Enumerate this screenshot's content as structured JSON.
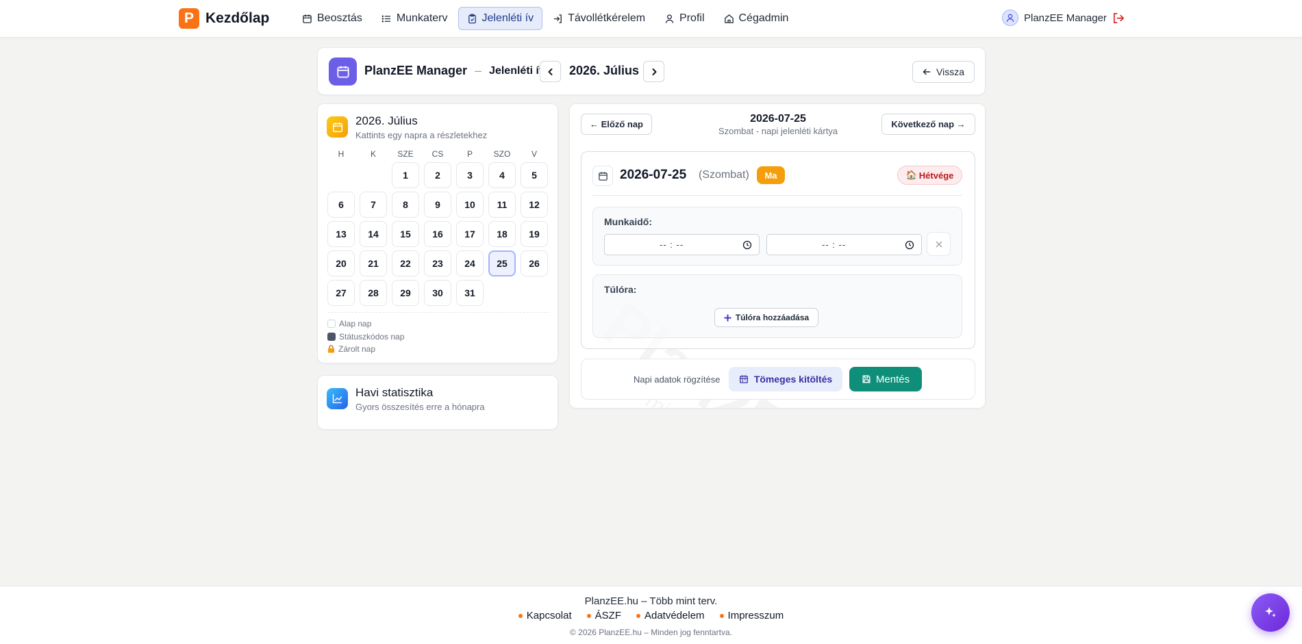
{
  "brand": {
    "logo_letter": "P",
    "name": "Kezdőlap",
    "accent": "#f97316"
  },
  "nav": [
    {
      "label": "Beosztás",
      "icon": "calendar-icon",
      "active": false
    },
    {
      "label": "Munkaterv",
      "icon": "list-icon",
      "active": false
    },
    {
      "label": "Jelenléti ív",
      "icon": "clipboard-icon",
      "active": true
    },
    {
      "label": "Távollétkérelem",
      "icon": "login-icon",
      "active": false
    },
    {
      "label": "Profil",
      "icon": "user-icon",
      "active": false
    },
    {
      "label": "Cégadmin",
      "icon": "home-icon",
      "active": false
    }
  ],
  "user": {
    "name": "PlanzEE Manager"
  },
  "header": {
    "company": "PlanzEE Manager",
    "separator": "–",
    "page": "Jelenléti ív",
    "month": "2026. Július",
    "back_label": "Vissza"
  },
  "calendar": {
    "title": "2026. Július",
    "subtitle": "Kattints egy napra a részletekhez",
    "weekdays": [
      "H",
      "K",
      "SZE",
      "CS",
      "P",
      "SZO",
      "V"
    ],
    "days": [
      "1",
      "2",
      "3",
      "4",
      "5",
      "6",
      "7",
      "8",
      "9",
      "10",
      "11",
      "12",
      "13",
      "14",
      "15",
      "16",
      "17",
      "18",
      "19",
      "20",
      "21",
      "22",
      "23",
      "24",
      "25",
      "26",
      "27",
      "28",
      "29",
      "30",
      "31"
    ],
    "selected": "25",
    "legend": [
      "Alap nap",
      "Státuszkódos nap",
      "Zárolt nap"
    ]
  },
  "stats": {
    "title": "Havi statisztika",
    "subtitle": "Gyors összesítés erre a hónapra"
  },
  "day_view": {
    "prev_label": "← Előző nap",
    "next_label": "Következő nap →",
    "date": "2026-07-25",
    "subtitle": "Szombat - napi jelenléti kártya",
    "day_name": "(Szombat)",
    "today_badge": "Ma",
    "weekend_badge": "Hétvége",
    "weekend_emoji": "🏠",
    "work_time_label": "Munkaidő:",
    "time_start": "-- : --",
    "time_end": "-- : --",
    "overtime_label": "Túlóra:",
    "add_overtime_label": "Túlóra hozzáadása",
    "watermark_main": "PlanzEE",
    "watermark_sub": "Több mint terv"
  },
  "actions": {
    "label": "Napi adatok rögzítése",
    "bulk_label": "Tömeges kitöltés",
    "save_label": "Mentés"
  },
  "footer": {
    "tagline": "PlanzEE.hu – Több mint terv.",
    "links": [
      "Kapcsolat",
      "ÁSZF",
      "Adatvédelem",
      "Impresszum"
    ],
    "copyright": "© 2026 PlanzEE.hu – Minden jog fenntartva."
  },
  "colors": {
    "primary": "#6d5ee8",
    "save": "#0f8f7a",
    "today": "#f59e0b",
    "weekend": "#b91c1c",
    "logout": "#dc2626"
  }
}
